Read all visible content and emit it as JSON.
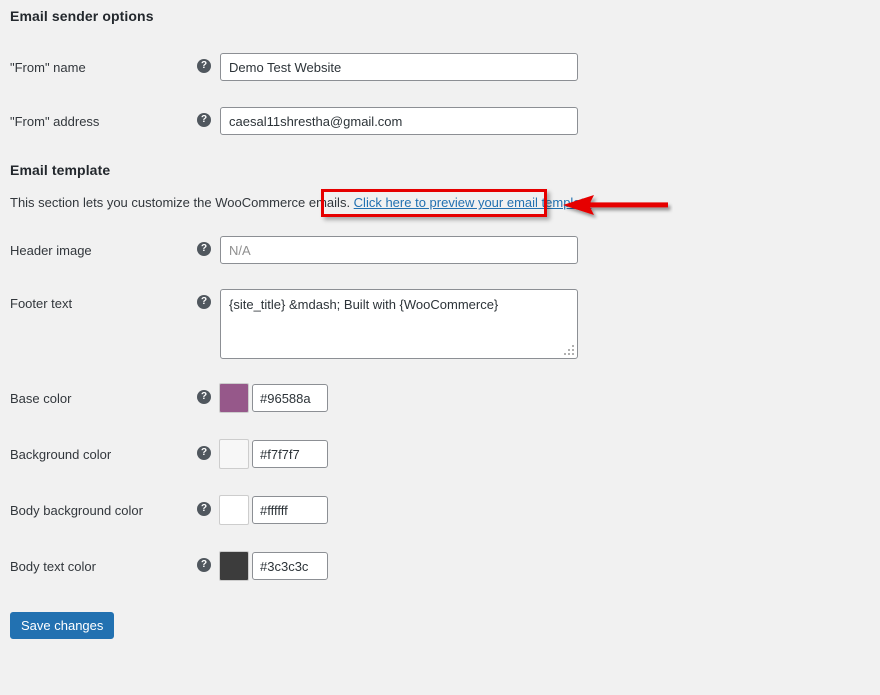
{
  "sections": {
    "sender": {
      "heading": "Email sender options",
      "fields": [
        {
          "label": "\"From\" name",
          "help_icon": "question-mark-icon",
          "value": "Demo Test Website",
          "placeholder": ""
        },
        {
          "label": "\"From\" address",
          "help_icon": "question-mark-icon",
          "value": "caesal11shrestha@gmail.com",
          "placeholder": ""
        }
      ]
    },
    "template": {
      "heading": "Email template",
      "description_prefix": "This section lets you customize the WooCommerce emails. ",
      "link_text": "Click here to preview your email template",
      "description_suffix": ".",
      "header_image": {
        "label": "Header image",
        "help_icon": "question-mark-icon",
        "value": "",
        "placeholder": "N/A"
      },
      "footer_text": {
        "label": "Footer text",
        "help_icon": "question-mark-icon",
        "value": "{site_title} &mdash; Built with {WooCommerce}",
        "placeholder": ""
      },
      "colors": [
        {
          "label": "Base color",
          "help_icon": "question-mark-icon",
          "value": "#96588a",
          "swatch": "#96588a"
        },
        {
          "label": "Background color",
          "help_icon": "question-mark-icon",
          "value": "#f7f7f7",
          "swatch": "#f7f7f7"
        },
        {
          "label": "Body background color",
          "help_icon": "question-mark-icon",
          "value": "#ffffff",
          "swatch": "#ffffff"
        },
        {
          "label": "Body text color",
          "help_icon": "question-mark-icon",
          "value": "#3c3c3c",
          "swatch": "#3c3c3c"
        }
      ]
    }
  },
  "submit": {
    "label": "Save changes"
  },
  "annotation": {
    "box_color": "#e60000",
    "arrow_color": "#e60000",
    "arrow_icon": "left-arrow-icon",
    "target": "Click here to preview your email template"
  },
  "help_glyph": "?"
}
